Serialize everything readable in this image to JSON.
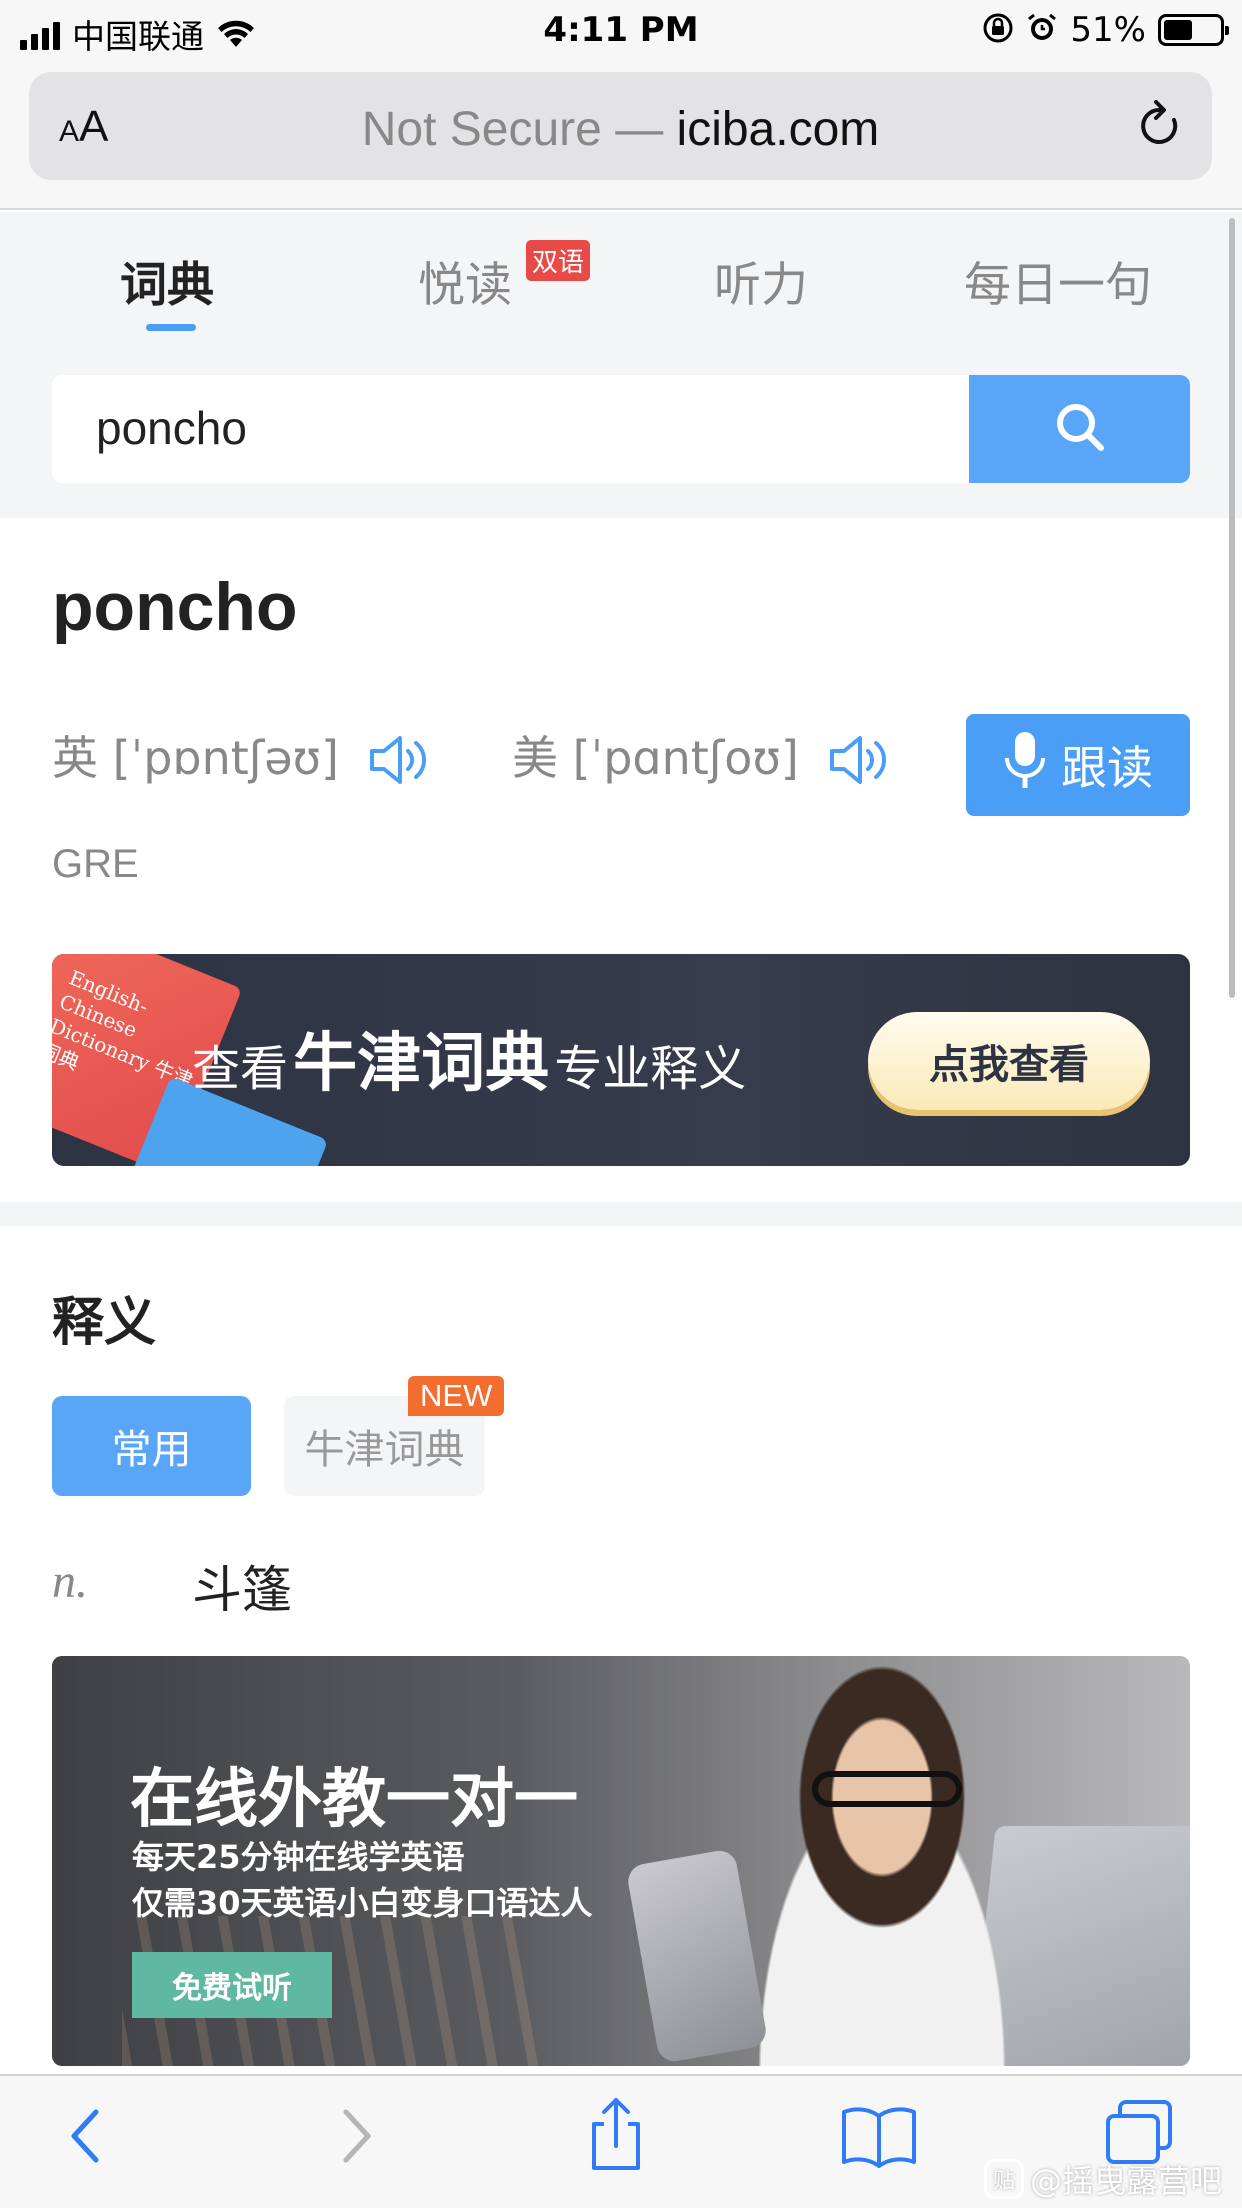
{
  "status_bar": {
    "carrier": "中国联通",
    "time": "4:11 PM",
    "battery_percent": "51%",
    "battery_level": 0.51
  },
  "browser": {
    "aa_small": "A",
    "aa_big": "A",
    "security_label": "Not Secure —",
    "domain": "iciba.com"
  },
  "nav_tabs": [
    {
      "label": "词典",
      "active": true
    },
    {
      "label": "悦读",
      "badge": "双语"
    },
    {
      "label": "听力"
    },
    {
      "label": "每日一句"
    }
  ],
  "search": {
    "value": "poncho"
  },
  "word": {
    "headword": "poncho",
    "uk": "英 [ˈpɒntʃəʊ]",
    "us": "美 [ˈpɑntʃoʊ]",
    "follow_label": "跟读",
    "tag": "GRE"
  },
  "oxford_banner": {
    "book_title": "English-Chinese Dictionary 牛津词典",
    "text_before": "查看",
    "text_bold": "牛津词典",
    "text_after": "专业释义",
    "button": "点我查看"
  },
  "definition": {
    "title": "释义",
    "tabs": [
      {
        "label": "常用",
        "active": true
      },
      {
        "label": "牛津词典",
        "badge": "NEW"
      }
    ],
    "entries": [
      {
        "pos": "n.",
        "meaning": "斗篷"
      }
    ]
  },
  "ad_banner": {
    "headline": "在线外教一对一",
    "line1": "每天25分钟在线学英语",
    "line2": "仅需30天英语小白变身口语达人",
    "button": "免费试听"
  },
  "watermark": {
    "logo": "贴",
    "text": "@摇曳露营吧"
  },
  "colors": {
    "accent_blue": "#59a6f8",
    "badge_red": "#e84a47",
    "badge_orange": "#f26d2e",
    "ad_green": "#5fb9a2"
  }
}
